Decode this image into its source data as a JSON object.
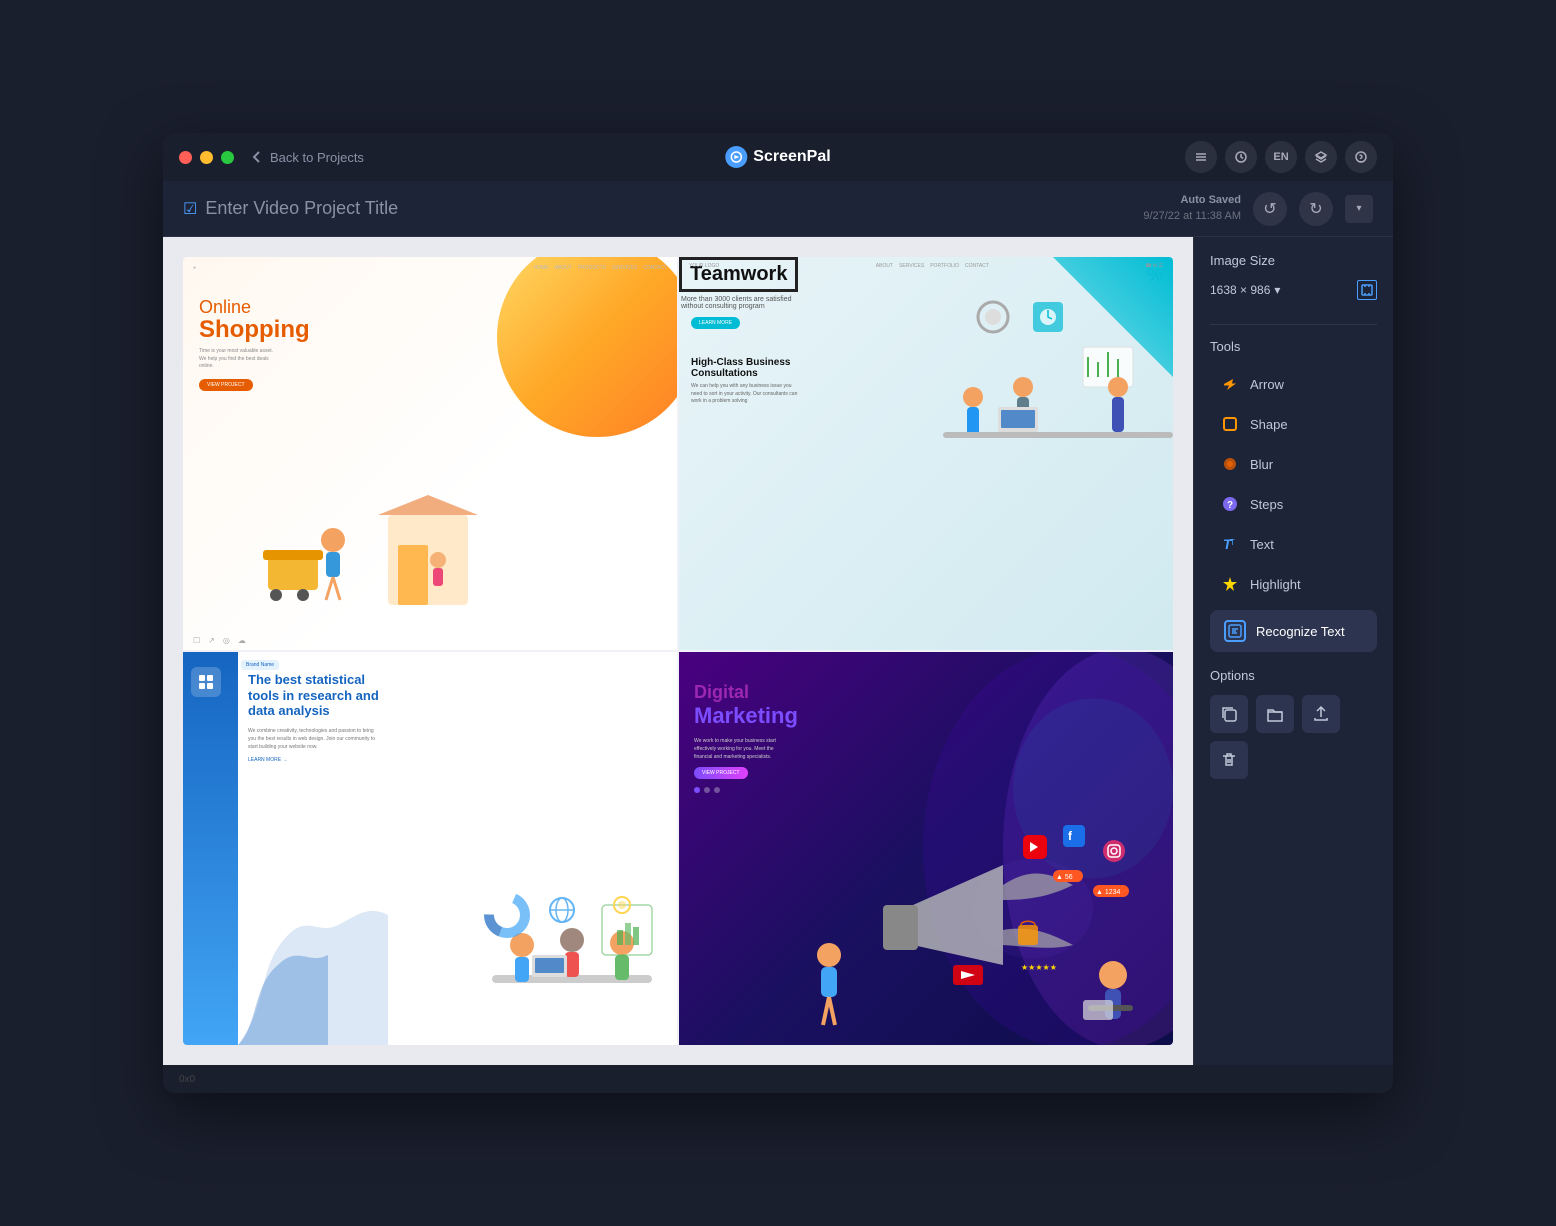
{
  "window": {
    "title": "ScreenPal",
    "back_label": "Back to Projects"
  },
  "header": {
    "project_title_placeholder": "Enter Video Project Title",
    "auto_saved_label": "Auto Saved",
    "auto_saved_date": "9/27/22 at 11:38 AM",
    "undo_label": "Undo",
    "redo_label": "Redo"
  },
  "right_panel": {
    "image_size_label": "Image Size",
    "image_size_value": "1638 × 986",
    "tools_label": "Tools",
    "tools": [
      {
        "id": "arrow",
        "label": "Arrow",
        "icon": "→"
      },
      {
        "id": "shape",
        "label": "Shape",
        "icon": "□"
      },
      {
        "id": "blur",
        "label": "Blur",
        "icon": "●"
      },
      {
        "id": "steps",
        "label": "Steps",
        "icon": "?"
      },
      {
        "id": "text",
        "label": "Text",
        "icon": "T"
      },
      {
        "id": "highlight",
        "label": "Highlight",
        "icon": "✦"
      }
    ],
    "recognize_text_label": "Recognize Text",
    "options_label": "Options"
  },
  "slides": [
    {
      "id": "slide-1",
      "title": "Online Shopping",
      "type": "online-shopping"
    },
    {
      "id": "slide-2",
      "title": "Teamwork",
      "type": "teamwork"
    },
    {
      "id": "slide-3",
      "title": "Statistical Tools",
      "type": "statistical"
    },
    {
      "id": "slide-4",
      "title": "Digital Marketing",
      "type": "digital-marketing"
    }
  ],
  "toolbar": {
    "settings_icon": "list",
    "clock_icon": "clock",
    "lang": "EN",
    "layers_icon": "layers",
    "help_icon": "?"
  }
}
